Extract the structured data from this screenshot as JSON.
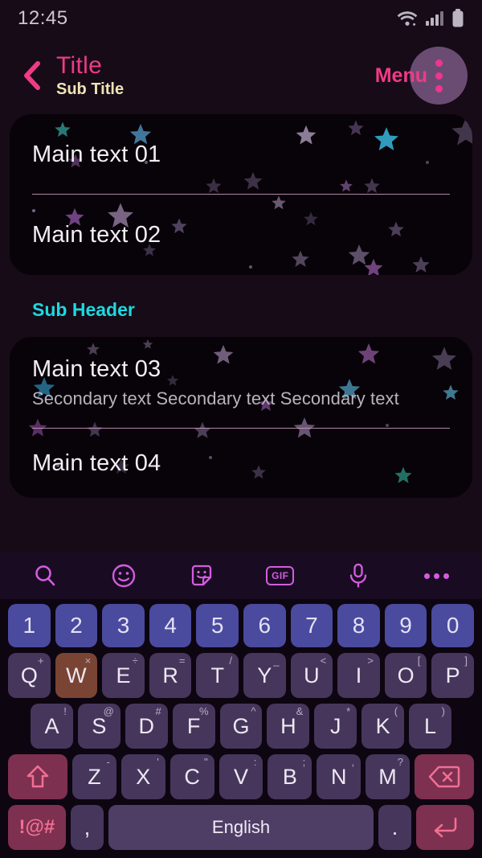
{
  "statusbar": {
    "time": "12:45",
    "icons": [
      "wifi-icon",
      "signal-icon",
      "battery-icon"
    ]
  },
  "appbar": {
    "back_icon": "chevron-left-icon",
    "title": "Title",
    "subtitle": "Sub Title",
    "menu_label": "Menu",
    "overflow_icon": "more-vertical-icon",
    "title_color": "#ef3b86",
    "subtitle_color": "#f0e3b4",
    "circle_color": "#6a4c73"
  },
  "content": {
    "card1": {
      "rows": [
        {
          "main": "Main text 01"
        },
        {
          "main": "Main text 02"
        }
      ]
    },
    "sub_header": "Sub Header",
    "sub_header_color": "#1fd8e0",
    "card2": {
      "rows": [
        {
          "main": "Main text 03",
          "secondary": "Secondary text Secondary text Secondary text"
        },
        {
          "main": "Main text 04"
        }
      ]
    }
  },
  "keyboard": {
    "toolbar": [
      {
        "name": "search-icon",
        "label": ""
      },
      {
        "name": "emoji-icon",
        "label": ""
      },
      {
        "name": "sticker-icon",
        "label": ""
      },
      {
        "name": "gif-icon",
        "label": "GIF"
      },
      {
        "name": "microphone-icon",
        "label": ""
      },
      {
        "name": "more-horizontal-icon",
        "label": ""
      }
    ],
    "row_numbers": [
      {
        "label": "1"
      },
      {
        "label": "2"
      },
      {
        "label": "3"
      },
      {
        "label": "4"
      },
      {
        "label": "5"
      },
      {
        "label": "6"
      },
      {
        "label": "7"
      },
      {
        "label": "8"
      },
      {
        "label": "9"
      },
      {
        "label": "0"
      }
    ],
    "row_q": [
      {
        "label": "Q",
        "sup": "+"
      },
      {
        "label": "W",
        "sup": "×",
        "state": "pressed"
      },
      {
        "label": "E",
        "sup": "÷"
      },
      {
        "label": "R",
        "sup": "="
      },
      {
        "label": "T",
        "sup": "/"
      },
      {
        "label": "Y",
        "sup": "_"
      },
      {
        "label": "U",
        "sup": "<"
      },
      {
        "label": "I",
        "sup": ">"
      },
      {
        "label": "O",
        "sup": "["
      },
      {
        "label": "P",
        "sup": "]"
      }
    ],
    "row_a": [
      {
        "label": "A",
        "sup": "!"
      },
      {
        "label": "S",
        "sup": "@"
      },
      {
        "label": "D",
        "sup": "#"
      },
      {
        "label": "F",
        "sup": "%"
      },
      {
        "label": "G",
        "sup": "^"
      },
      {
        "label": "H",
        "sup": "&"
      },
      {
        "label": "J",
        "sup": "*"
      },
      {
        "label": "K",
        "sup": "("
      },
      {
        "label": "L",
        "sup": ")"
      }
    ],
    "row_z": [
      {
        "label": "Z",
        "sup": "-"
      },
      {
        "label": "X",
        "sup": "'"
      },
      {
        "label": "C",
        "sup": "\""
      },
      {
        "label": "V",
        "sup": ":"
      },
      {
        "label": "B",
        "sup": ";"
      },
      {
        "label": "N",
        "sup": ","
      },
      {
        "label": "M",
        "sup": "?"
      }
    ],
    "shift_icon": "shift-arrow-icon",
    "backspace_icon": "backspace-icon",
    "symbols_label": "!@#",
    "comma_label": ",",
    "space_label": "English",
    "period_label": ".",
    "enter_icon": "enter-return-icon",
    "key_color": "#46365c",
    "number_key_color": "#4a4a9e",
    "accent_key_color": "#7d3050",
    "pressed_key_color": "#7a4434"
  }
}
